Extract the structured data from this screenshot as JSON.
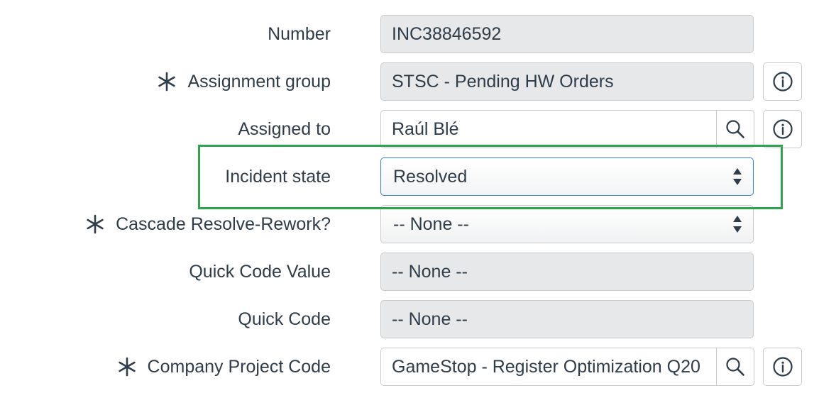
{
  "form": {
    "number": {
      "label": "Number",
      "value": "INC38846592"
    },
    "assignment_group": {
      "label": "Assignment group",
      "value": "STSC - Pending HW Orders",
      "required": true
    },
    "assigned_to": {
      "label": "Assigned to",
      "value": "Raúl Blé"
    },
    "incident_state": {
      "label": "Incident state",
      "value": "Resolved"
    },
    "cascade_resolve_rework": {
      "label": "Cascade Resolve-Rework?",
      "value": "-- None --",
      "required": true
    },
    "quick_code_value": {
      "label": "Quick Code Value",
      "value": "-- None --"
    },
    "quick_code": {
      "label": "Quick Code",
      "value": "-- None --"
    },
    "company_project_code": {
      "label": "Company Project Code",
      "value": "GameStop - Register Optimization Q20",
      "required": true
    }
  },
  "icons": {
    "required": "asterisk-icon",
    "lookup": "magnifier-icon",
    "info": "info-circle-icon",
    "select": "updown-arrows-icon"
  },
  "colors": {
    "highlight": "#2ea44f",
    "focus": "#3b7fd8",
    "readonly_bg": "#e6e8ea",
    "text": "#2e3d49"
  }
}
